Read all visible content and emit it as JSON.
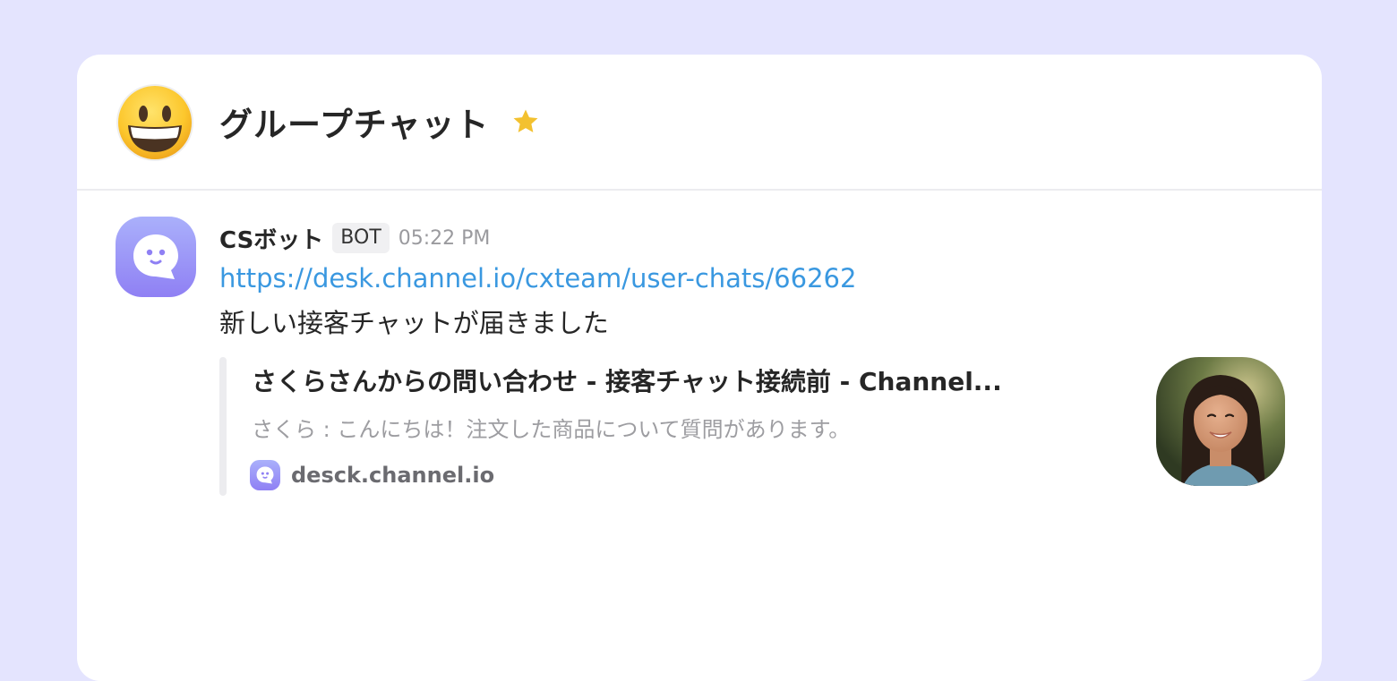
{
  "channel": {
    "title": "グループチャット",
    "avatar_icon": "grinning-face-emoji-icon",
    "favorite_icon": "star-icon"
  },
  "message": {
    "sender": "CSボット",
    "badge": "BOT",
    "time": "05:22 PM",
    "link": "https://desk.channel.io/cxteam/user-chats/66262",
    "text": "新しい接客チャットが届きました",
    "avatar_icon": "channel-bot-icon"
  },
  "preview": {
    "title": "さくらさんからの問い合わせ - 接客チャット接続前 - Channel...",
    "description": "さくら : こんにちは！注文した商品について質問があります。",
    "site_icon": "channel-bot-icon",
    "site": "desck.channel.io",
    "thumbnail": "user-photo"
  },
  "colors": {
    "background": "#e4e4fe",
    "link": "#3a98e0",
    "bot_gradient_top": "#aab0fb",
    "bot_gradient_bottom": "#8f80f4",
    "star": "#f3c12f"
  }
}
